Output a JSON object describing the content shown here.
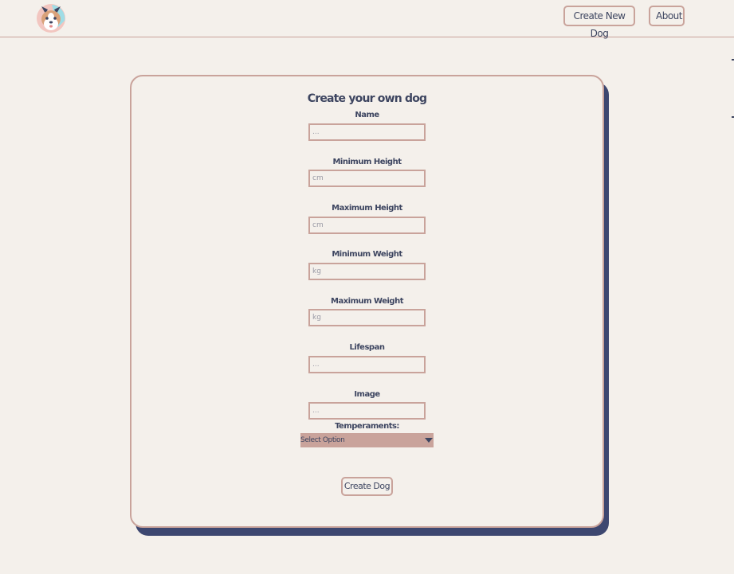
{
  "header": {
    "logo_icon": "shiba-dog-logo-icon",
    "nav": {
      "create_label": "Create New Dog",
      "about_label": "About"
    }
  },
  "form": {
    "title": "Create your own dog",
    "fields": [
      {
        "label": "Name",
        "placeholder": "..."
      },
      {
        "label": "Minimum Height",
        "placeholder": "cm"
      },
      {
        "label": "Maximum Height",
        "placeholder": "cm"
      },
      {
        "label": "Minimum Weight",
        "placeholder": "kg"
      },
      {
        "label": "Maximum Weight",
        "placeholder": "kg"
      },
      {
        "label": "Lifespan",
        "placeholder": "..."
      },
      {
        "label": "Image",
        "placeholder": "..."
      }
    ],
    "temperaments": {
      "label": "Temperaments:",
      "selected": "Select Option"
    },
    "submit_label": "Create Dog"
  },
  "colors": {
    "background": "#f4f0eb",
    "accent": "#c9a39b",
    "text": "#3d4560",
    "shadow": "#3d4770"
  }
}
